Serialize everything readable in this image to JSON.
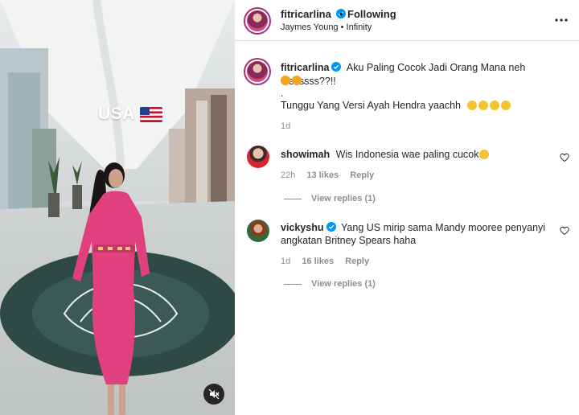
{
  "media": {
    "overlay_text": "USA",
    "flag_emoji_name": "us-flag",
    "mute_icon": "speaker-muted-icon"
  },
  "header": {
    "username": "fitricarlina",
    "dot": "•",
    "follow_state": "Following",
    "audio_line": "Jaymes Young • Infinity",
    "more_icon": "more-horizontal-icon"
  },
  "caption": {
    "username": "fitricarlina",
    "text_line1": "Aku Paling Cocok Jadi Orang Mana neh Gesssss??!!",
    "dot_line": ".",
    "text_line3": "Tunggu Yang Versi Ayah Hendra yaachh",
    "time": "1d"
  },
  "comments": [
    {
      "username": "showimah",
      "text": "Wis Indonesia wae paling cucok",
      "time": "22h",
      "likes": "13 likes",
      "reply": "Reply",
      "view_replies": "View replies (1)"
    },
    {
      "username": "vickyshu",
      "text_line1": "Yang US mirip sama Mandy mooree penyanyi",
      "text_line2": "angkatan Britney Spears haha",
      "time": "1d",
      "likes": "16 likes",
      "reply": "Reply",
      "view_replies": "View replies (1)"
    }
  ],
  "colors": {
    "verified_blue": "#0095f6",
    "text_primary": "#262626",
    "text_secondary": "#8e8e8e",
    "dress_pink": "#e0417e"
  }
}
